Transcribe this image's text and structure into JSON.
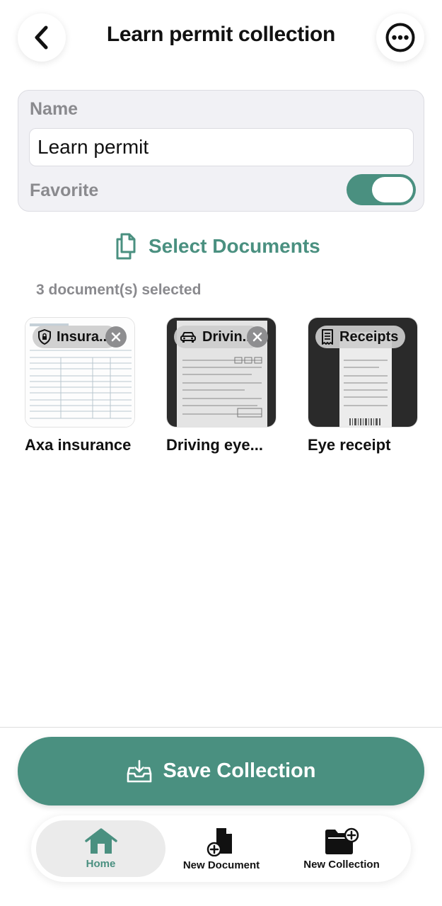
{
  "header": {
    "title": "Learn permit collection",
    "back_icon": "chevron-left-icon",
    "more_icon": "ellipsis-circle-icon"
  },
  "form": {
    "name_label": "Name",
    "name_value": "Learn permit",
    "favorite_label": "Favorite",
    "favorite_on": true
  },
  "select_documents": {
    "label": "Select Documents",
    "icon": "documents-icon"
  },
  "selected_count": "3 document(s) selected",
  "documents": [
    {
      "tag": "Insura...",
      "tag_icon": "shield-lock-icon",
      "name": "Axa insurance"
    },
    {
      "tag": "Drivin...",
      "tag_icon": "car-icon",
      "name": "Driving eye..."
    },
    {
      "tag": "Receipts",
      "tag_icon": "receipt-icon",
      "name": "Eye receipt"
    }
  ],
  "save_button": {
    "label": "Save Collection",
    "icon": "tray-download-icon"
  },
  "tabs": [
    {
      "label": "Home",
      "icon": "house-icon",
      "active": true
    },
    {
      "label": "New Document",
      "icon": "document-plus-icon",
      "active": false
    },
    {
      "label": "New Collection",
      "icon": "folder-plus-icon",
      "active": false
    }
  ],
  "colors": {
    "accent": "#4a9080",
    "muted": "#8a8a8e",
    "card": "#f1f1f5"
  }
}
